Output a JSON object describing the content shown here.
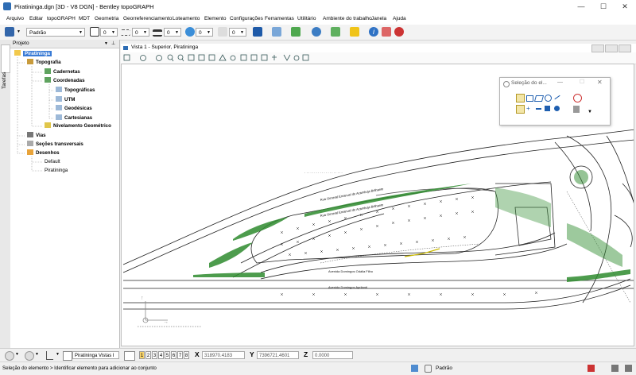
{
  "window": {
    "title": "Piratininga.dgn [3D - V8 DGN] - Bentley topoGRAPH"
  },
  "menu": [
    "Arquivo",
    "Editar",
    "topoGRAPH",
    "MDT",
    "Geometria",
    "Georreferenciamento",
    "Loteamento",
    "Elemento",
    "Configurações",
    "Ferramentas",
    "Utilitário",
    "Ambiente do trabalho",
    "Janela",
    "Ajuda"
  ],
  "toolbar": {
    "level": "Padrão",
    "color_val": "0",
    "style_val": "0",
    "weight_val": "0",
    "trans_val": "0",
    "prio_val": "0"
  },
  "sidebar": {
    "tab_label": "Tarefas"
  },
  "project": {
    "header": "Projeto",
    "items": [
      "Piratininga",
      "Topografia",
      "Cadernetas",
      "Coordenadas",
      "Topográficas",
      "UTM",
      "Geodésicas",
      "Cartesianas",
      "Nivelamento Geométrico",
      "Vias",
      "Seções transversais",
      "Desenhos",
      "Default",
      "Piratininga"
    ]
  },
  "view": {
    "title": "Vista 1 - Superior, Piratininga"
  },
  "selection_window": {
    "title": "Seleção do el..."
  },
  "statusbar": {
    "view_set": "Piratininga Vistas I",
    "views": [
      "1",
      "2",
      "3",
      "4",
      "5",
      "6",
      "7",
      "8"
    ],
    "x_label": "X",
    "x_value": "318970.4183",
    "y_label": "Y",
    "y_value": "7396721.4601",
    "z_label": "Z",
    "z_value": "0.0000",
    "message": "Seleção do elemento > Identificar elemento para adicionar ao conjunto",
    "level": "Padrão"
  },
  "colors": {
    "accent": "#3a7bd5",
    "vegetation": "#2e8b2e"
  }
}
